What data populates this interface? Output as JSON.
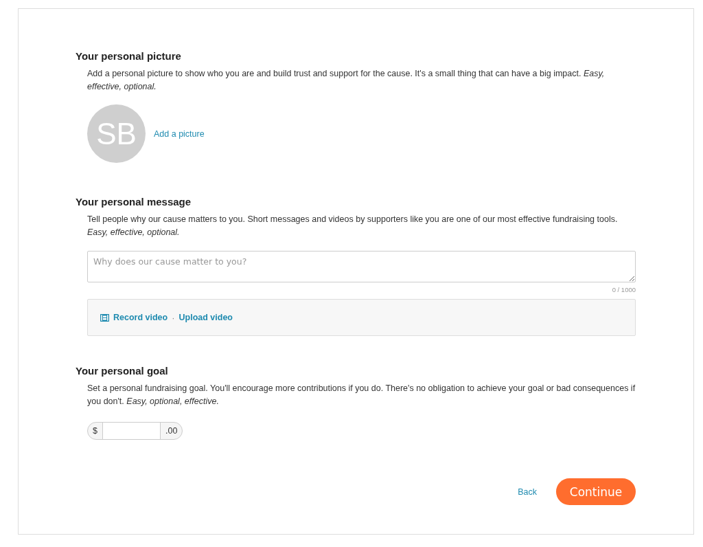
{
  "picture_section": {
    "heading": "Your personal picture",
    "description": "Add a personal picture to show who you are and build trust and support for the cause. It's a small thing that can have a big impact. *Easy, effective, optional.*",
    "avatar_initials": "SB",
    "add_link": "Add a picture"
  },
  "message_section": {
    "heading": "Your personal message",
    "description": "Tell people why our cause matters to you. Short messages and videos by supporters like you are one of our most effective fundraising tools. *Easy, effective, optional.*",
    "placeholder": "Why does our cause matter to you?",
    "counter": "0 / 1000",
    "record_link": "Record video",
    "separator": "·",
    "upload_link": "Upload video"
  },
  "goal_section": {
    "heading": "Your personal goal",
    "description": "Set a personal fundraising goal. You'll encourage more contributions if you do. There's no obligation to achieve your goal or bad consequences if you don't. *Easy, optional, effective.*",
    "currency": "$",
    "cents": ".00"
  },
  "actions": {
    "back": "Back",
    "continue": "Continue"
  }
}
